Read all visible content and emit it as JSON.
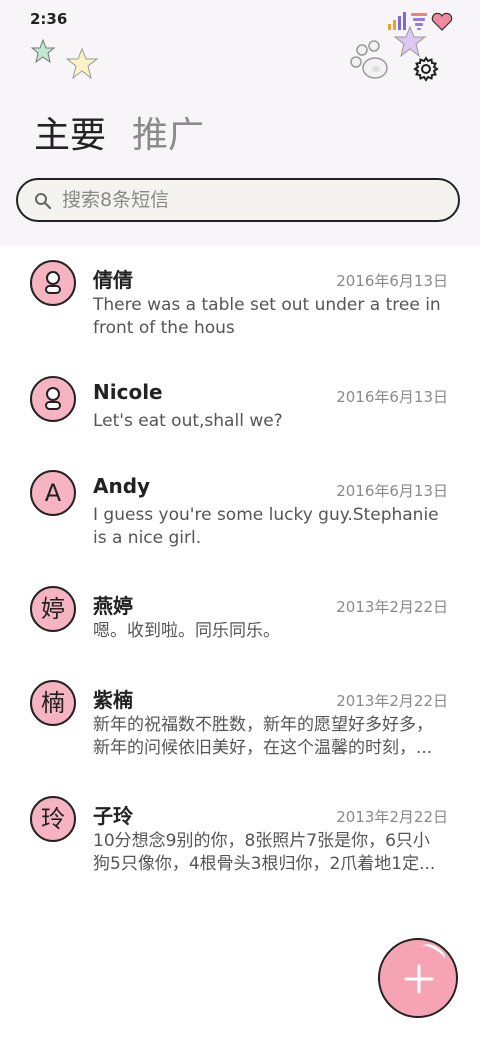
{
  "status_bar": {
    "time": "2:36",
    "icons": [
      "signal-icon",
      "wifi-icon",
      "heart-icon"
    ]
  },
  "tabs": [
    {
      "label": "主要",
      "active": true
    },
    {
      "label": "推广",
      "active": false
    }
  ],
  "search": {
    "placeholder": "搜索8条短信",
    "value": ""
  },
  "colors": {
    "header_bg": "#f7f5f7",
    "avatar_pink": "#f6b4c2",
    "fab_pink": "#f6a4b4",
    "text_primary": "#222222",
    "text_secondary": "#8a8a8a"
  },
  "messages": [
    {
      "avatar": "",
      "avatar_icon": "person-icon",
      "name": "倩倩",
      "date": "2016年6月13日",
      "preview": "There was a table set out under a tree in front of the hous"
    },
    {
      "avatar": "",
      "avatar_icon": "person-icon",
      "name": "Nicole",
      "date": "2016年6月13日",
      "preview": "Let's eat out,shall we?"
    },
    {
      "avatar": "A",
      "name": "Andy",
      "date": "2016年6月13日",
      "preview": "I guess you're some lucky guy.Stephanie is a nice girl."
    },
    {
      "avatar": "婷",
      "name": "燕婷",
      "date": "2013年2月22日",
      "preview": "嗯。收到啦。同乐同乐。"
    },
    {
      "avatar": "楠",
      "name": "紫楠",
      "date": "2013年2月22日",
      "preview": "新年的祝福数不胜数，新年的愿望好多好多，新年的问候依旧美好，在这个温馨的时刻，..."
    },
    {
      "avatar": "玲",
      "name": "子玲",
      "date": "2013年2月22日",
      "preview": "10分想念9别的你，8张照片7张是你，6只小狗5只像你，4根骨头3根归你，2爪着地1定..."
    }
  ],
  "fab": {
    "icon": "plus-icon"
  }
}
